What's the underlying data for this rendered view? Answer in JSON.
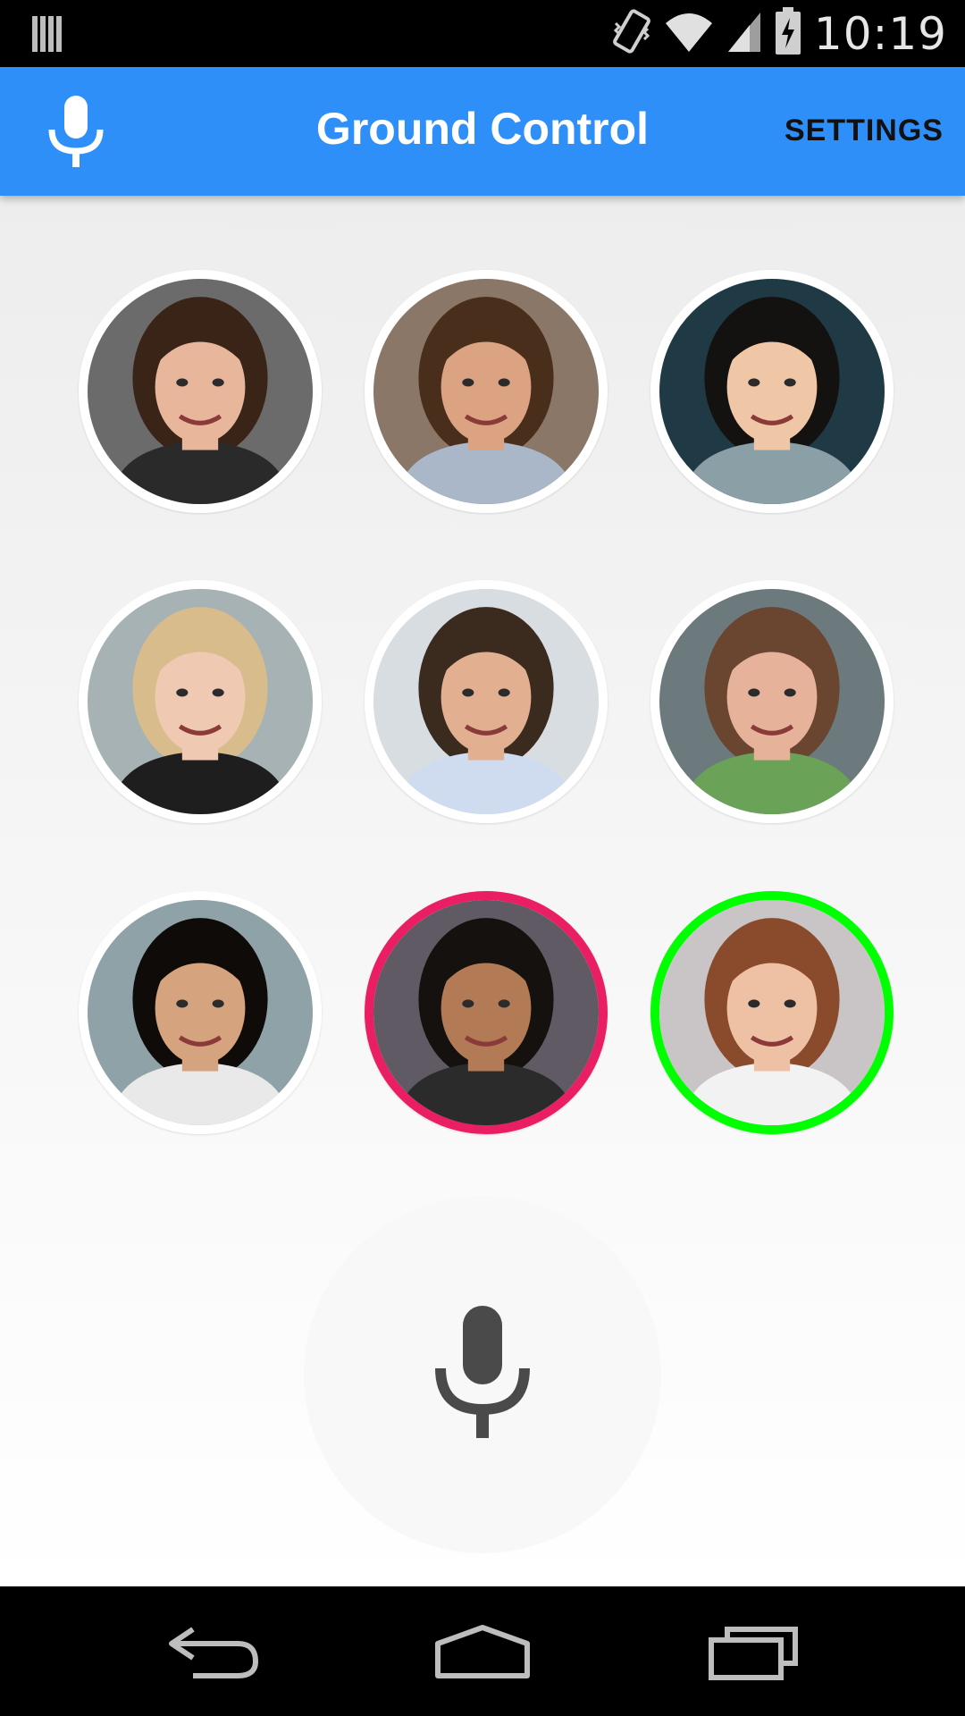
{
  "status_bar": {
    "time": "10:19",
    "icons": [
      "barcode-icon",
      "vibrate-icon",
      "wifi-icon",
      "cell-signal-icon",
      "battery-charging-icon"
    ]
  },
  "app_bar": {
    "title": "Ground Control",
    "settings_label": "SETTINGS",
    "mic_icon": "microphone-icon"
  },
  "contacts": [
    {
      "ring": "none",
      "skin": "#e8b79b",
      "hair": "#3a2418",
      "bg": "#6b6b6b",
      "shirt": "#2a2a2a"
    },
    {
      "ring": "none",
      "skin": "#dba381",
      "hair": "#4a2e1c",
      "bg": "#8a7768",
      "shirt": "#a9b7c9"
    },
    {
      "ring": "none",
      "skin": "#efc6a6",
      "hair": "#141210",
      "bg": "#1f3a45",
      "shirt": "#8aa0a6"
    },
    {
      "ring": "none",
      "skin": "#efc9b2",
      "hair": "#d9bc8c",
      "bg": "#a6b2b4",
      "shirt": "#1e1e1e"
    },
    {
      "ring": "none",
      "skin": "#e2b090",
      "hair": "#3b2a1e",
      "bg": "#d8dde2",
      "shirt": "#cfdcf0"
    },
    {
      "ring": "none",
      "skin": "#e6b39a",
      "hair": "#6a4530",
      "bg": "#6c7a7e",
      "shirt": "#6aa257"
    },
    {
      "ring": "none",
      "skin": "#d6a37f",
      "hair": "#0e0b09",
      "bg": "#8fa2a8",
      "shirt": "#e9e9e9"
    },
    {
      "ring": "pink",
      "skin": "#b27a55",
      "hair": "#15110e",
      "bg": "#5f5a63",
      "shirt": "#2b2b2b"
    },
    {
      "ring": "green",
      "skin": "#efc1a4",
      "hair": "#8a4a2c",
      "bg": "#c9c4c6",
      "shirt": "#f2f2f2"
    }
  ],
  "big_mic_icon": "microphone-icon",
  "nav_bar": {
    "back_icon": "back-icon",
    "home_icon": "home-icon",
    "recents_icon": "recents-icon"
  }
}
